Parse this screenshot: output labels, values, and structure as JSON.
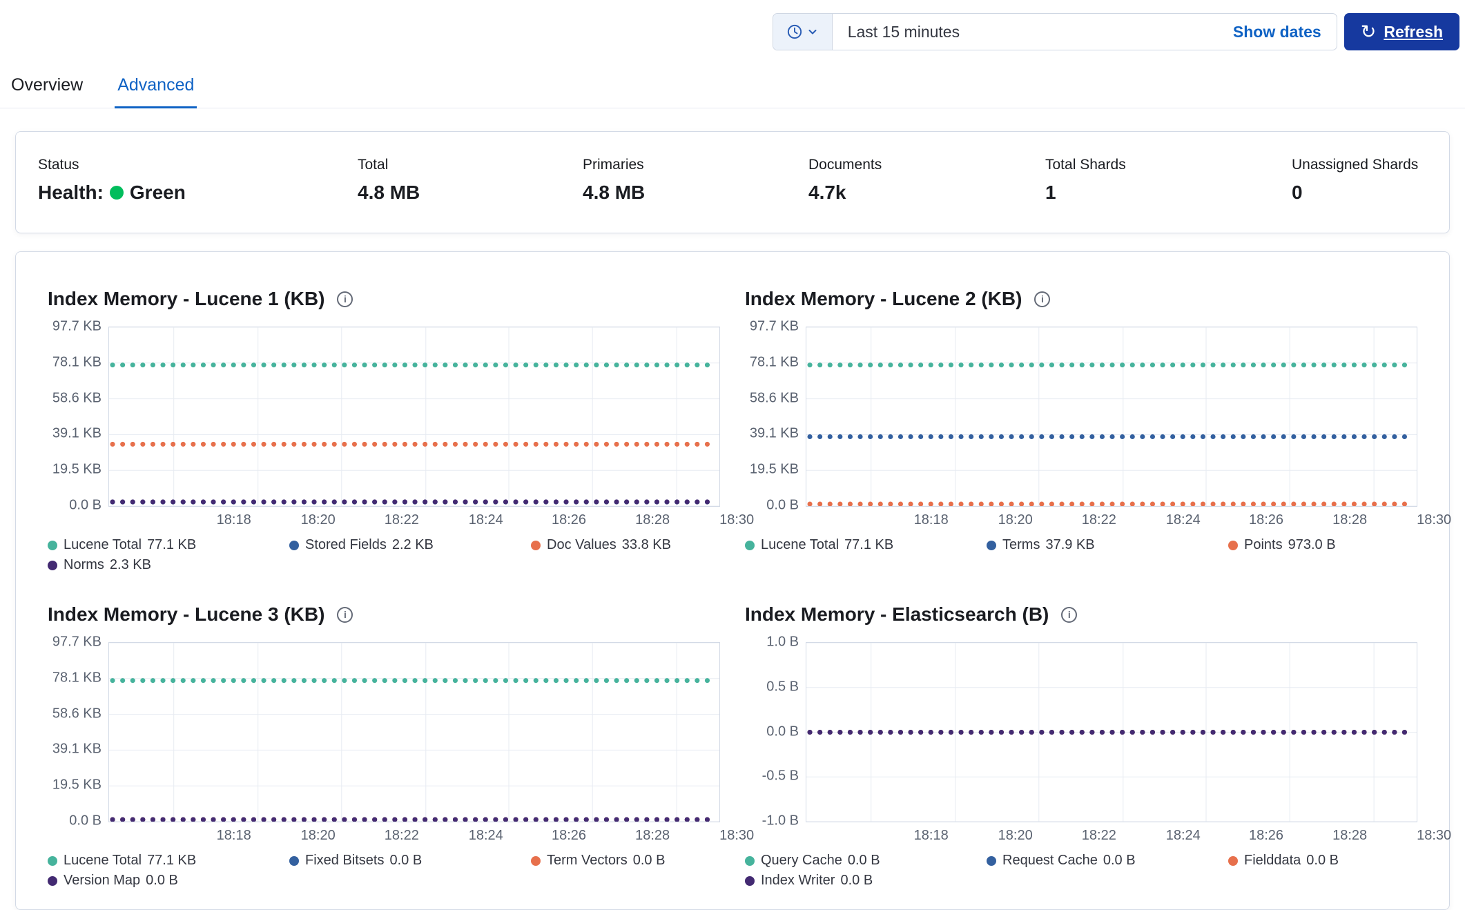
{
  "topbar": {
    "time_label": "Last 15 minutes",
    "show_dates_label": "Show dates",
    "refresh_label": "Refresh"
  },
  "tabs": [
    {
      "label": "Overview"
    },
    {
      "label": "Advanced"
    }
  ],
  "stats": {
    "items": [
      {
        "label": "Status",
        "prefix": "Health:",
        "value": "Green"
      },
      {
        "label": "Total",
        "value": "4.8 MB"
      },
      {
        "label": "Primaries",
        "value": "4.8 MB"
      },
      {
        "label": "Documents",
        "value": "4.7k"
      },
      {
        "label": "Total Shards",
        "value": "1"
      },
      {
        "label": "Unassigned Shards",
        "value": "0"
      }
    ]
  },
  "colors": {
    "teal": "#46b39c",
    "blue": "#33609f",
    "orange": "#e7704c",
    "purple": "#432a72",
    "health_green": "#00bd5c",
    "primary_blue": "#0f62c4",
    "refresh_bg": "#16399f"
  },
  "charts": [
    {
      "title": "Index Memory - Lucene 1 (KB)",
      "type": "line",
      "x_ticks": [
        "18:18",
        "18:20",
        "18:22",
        "18:24",
        "18:26",
        "18:28",
        "18:30"
      ],
      "y_ticks": [
        "97.7 KB",
        "78.1 KB",
        "58.6 KB",
        "39.1 KB",
        "19.5 KB",
        "0.0 B"
      ],
      "y_min": 0,
      "y_max": 97.7,
      "series": [
        {
          "name": "Lucene Total",
          "value": 77.1,
          "value_label": "77.1 KB",
          "color": "#46b39c"
        },
        {
          "name": "Stored Fields",
          "value": 2.2,
          "value_label": "2.2 KB",
          "color": "#33609f"
        },
        {
          "name": "Doc Values",
          "value": 33.8,
          "value_label": "33.8 KB",
          "color": "#e7704c"
        },
        {
          "name": "Norms",
          "value": 2.3,
          "value_label": "2.3 KB",
          "color": "#432a72"
        }
      ]
    },
    {
      "title": "Index Memory - Lucene 2 (KB)",
      "type": "line",
      "x_ticks": [
        "18:18",
        "18:20",
        "18:22",
        "18:24",
        "18:26",
        "18:28",
        "18:30"
      ],
      "y_ticks": [
        "97.7 KB",
        "78.1 KB",
        "58.6 KB",
        "39.1 KB",
        "19.5 KB",
        "0.0 B"
      ],
      "y_min": 0,
      "y_max": 97.7,
      "series": [
        {
          "name": "Lucene Total",
          "value": 77.1,
          "value_label": "77.1 KB",
          "color": "#46b39c"
        },
        {
          "name": "Terms",
          "value": 37.9,
          "value_label": "37.9 KB",
          "color": "#33609f"
        },
        {
          "name": "Points",
          "value": 0.95,
          "value_label": "973.0 B",
          "color": "#e7704c"
        }
      ]
    },
    {
      "title": "Index Memory - Lucene 3 (KB)",
      "type": "line",
      "x_ticks": [
        "18:18",
        "18:20",
        "18:22",
        "18:24",
        "18:26",
        "18:28",
        "18:30"
      ],
      "y_ticks": [
        "97.7 KB",
        "78.1 KB",
        "58.6 KB",
        "39.1 KB",
        "19.5 KB",
        "0.0 B"
      ],
      "y_min": 0,
      "y_max": 97.7,
      "series": [
        {
          "name": "Lucene Total",
          "value": 77.1,
          "value_label": "77.1 KB",
          "color": "#46b39c"
        },
        {
          "name": "Fixed Bitsets",
          "value": 0,
          "value_label": "0.0 B",
          "color": "#33609f"
        },
        {
          "name": "Term Vectors",
          "value": 0,
          "value_label": "0.0 B",
          "color": "#e7704c"
        },
        {
          "name": "Version Map",
          "value": 0,
          "value_label": "0.0 B",
          "color": "#432a72"
        }
      ]
    },
    {
      "title": "Index Memory - Elasticsearch (B)",
      "type": "line",
      "x_ticks": [
        "18:18",
        "18:20",
        "18:22",
        "18:24",
        "18:26",
        "18:28",
        "18:30"
      ],
      "y_ticks": [
        "1.0 B",
        "0.5 B",
        "0.0 B",
        "-0.5 B",
        "-1.0 B"
      ],
      "y_min": -1,
      "y_max": 1,
      "series": [
        {
          "name": "Query Cache",
          "value": 0,
          "value_label": "0.0 B",
          "color": "#46b39c"
        },
        {
          "name": "Request Cache",
          "value": 0,
          "value_label": "0.0 B",
          "color": "#33609f"
        },
        {
          "name": "Fielddata",
          "value": 0,
          "value_label": "0.0 B",
          "color": "#e7704c"
        },
        {
          "name": "Index Writer",
          "value": 0,
          "value_label": "0.0 B",
          "color": "#432a72"
        }
      ]
    }
  ]
}
